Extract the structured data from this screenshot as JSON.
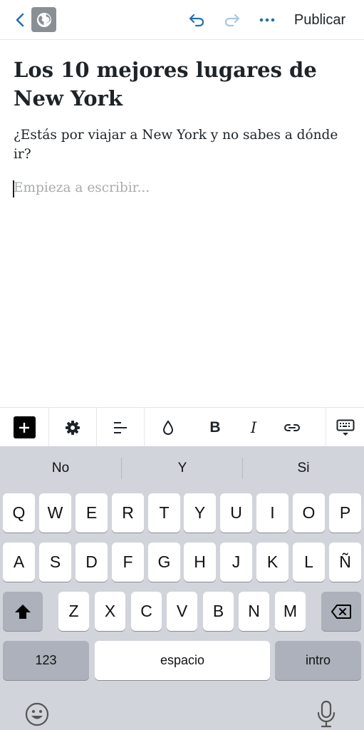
{
  "header": {
    "publish_label": "Publicar",
    "icons": [
      "chevron-left-icon",
      "globe-icon",
      "undo-icon",
      "redo-icon",
      "ellipsis-icon"
    ]
  },
  "post": {
    "title": "Los 10 mejores lugares de New York",
    "paragraph": "¿Estás por viajar a New York y no sabes a dónde ir?",
    "empty_block_placeholder": "Empieza a escribir..."
  },
  "toolbar": {
    "bold_label": "B",
    "italic_label": "I",
    "icons": [
      "plus-icon",
      "gear-icon",
      "align-icon",
      "droplet-icon",
      "link-icon",
      "keyboard-hide-icon"
    ]
  },
  "keyboard": {
    "suggestions": [
      "No",
      "Y",
      "Si"
    ],
    "row1": [
      "Q",
      "W",
      "E",
      "R",
      "T",
      "Y",
      "U",
      "I",
      "O",
      "P"
    ],
    "row2": [
      "A",
      "S",
      "D",
      "F",
      "G",
      "H",
      "J",
      "K",
      "L",
      "Ñ"
    ],
    "row3": [
      "Z",
      "X",
      "C",
      "V",
      "B",
      "N",
      "M"
    ],
    "numbers_label": "123",
    "space_label": "espacio",
    "return_label": "intro",
    "icons": [
      "shift-icon",
      "backspace-icon",
      "emoji-icon",
      "microphone-icon"
    ]
  },
  "colors": {
    "accent": "#2271b1",
    "disabled": "#a7c7e3",
    "keyboard_bg": "#d1d4da",
    "key_dark": "#acb1bb"
  }
}
